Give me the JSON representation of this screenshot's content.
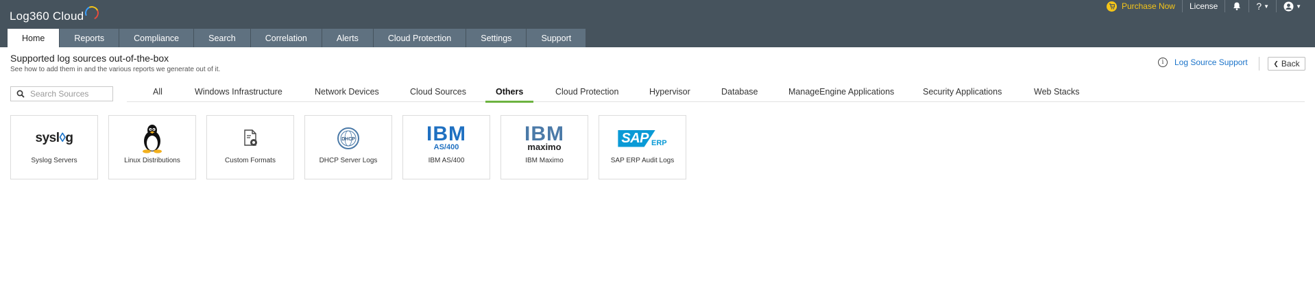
{
  "app": {
    "title": "Log360 Cloud"
  },
  "topbar": {
    "purchase_label": "Purchase Now",
    "license_label": "License",
    "help_label": "?"
  },
  "nav": {
    "tabs": [
      {
        "label": "Home"
      },
      {
        "label": "Reports"
      },
      {
        "label": "Compliance"
      },
      {
        "label": "Search"
      },
      {
        "label": "Correlation"
      },
      {
        "label": "Alerts"
      },
      {
        "label": "Cloud Protection"
      },
      {
        "label": "Settings"
      },
      {
        "label": "Support"
      }
    ],
    "active": "Home"
  },
  "page": {
    "title": "Supported log sources out-of-the-box",
    "subtitle": "See how to add them in and the various reports we generate out of it.",
    "log_source_support": "Log Source Support",
    "back_label": "Back"
  },
  "search": {
    "placeholder": "Search Sources"
  },
  "categories": {
    "items": [
      {
        "label": "All"
      },
      {
        "label": "Windows Infrastructure"
      },
      {
        "label": "Network Devices"
      },
      {
        "label": "Cloud Sources"
      },
      {
        "label": "Others"
      },
      {
        "label": "Cloud Protection"
      },
      {
        "label": "Hypervisor"
      },
      {
        "label": "Database"
      },
      {
        "label": "ManageEngine Applications"
      },
      {
        "label": "Security Applications"
      },
      {
        "label": "Web Stacks"
      }
    ],
    "active": "Others"
  },
  "sources": [
    {
      "label": "Syslog Servers",
      "logo_text": "sysl",
      "logo_text_tail": "g",
      "icon": "syslog-logo"
    },
    {
      "label": "Linux Distributions",
      "icon": "tux-penguin-icon"
    },
    {
      "label": "Custom Formats",
      "icon": "custom-format-gear-icon"
    },
    {
      "label": "DHCP Server Logs",
      "logo_text": "DHCP",
      "icon": "dhcp-globe-icon"
    },
    {
      "label": "IBM AS/400",
      "logo_text": "IBM",
      "logo_sub": "AS/400",
      "icon": "ibm-logo"
    },
    {
      "label": "IBM Maximo",
      "logo_text": "IBM",
      "logo_sub": "maximo",
      "icon": "ibm-maximo-logo"
    },
    {
      "label": "SAP ERP Audit Logs",
      "logo_text": "SAP",
      "logo_sub": "ERP",
      "icon": "sap-erp-logo"
    }
  ],
  "colors": {
    "header_bg": "#46535d",
    "tab_bg": "#5f7180",
    "accent_green": "#6cb33f",
    "link_blue": "#1a73c9",
    "purchase_yellow": "#f5c518"
  }
}
